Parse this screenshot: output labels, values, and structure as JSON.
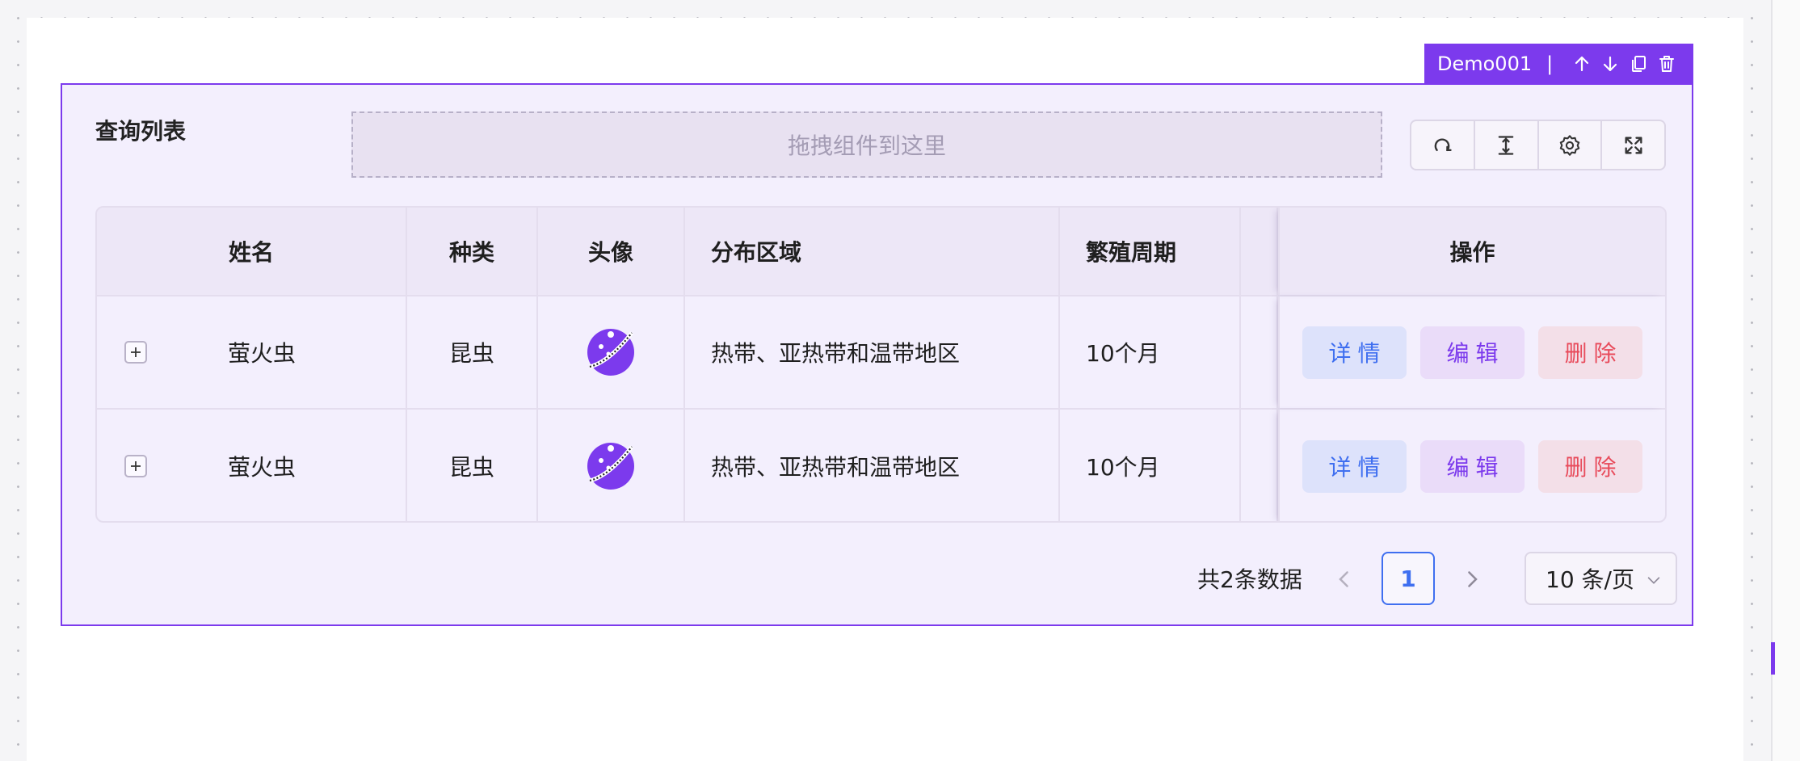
{
  "component_toolbar": {
    "name": "Demo001",
    "separator": "|",
    "icons": [
      "arrow-up-icon",
      "arrow-down-icon",
      "copy-icon",
      "trash-icon"
    ]
  },
  "list": {
    "title": "查询列表",
    "drop_zone_placeholder": "拖拽组件到这里",
    "tools": [
      "refresh-icon",
      "density-icon",
      "settings-icon",
      "fullscreen-icon"
    ]
  },
  "table": {
    "columns": {
      "name": "姓名",
      "type": "种类",
      "avatar": "头像",
      "region": "分布区域",
      "cycle": "繁殖周期",
      "ops": "操作"
    },
    "rows": [
      {
        "name": "萤火虫",
        "type": "昆虫",
        "region": "热带、亚热带和温带地区",
        "cycle": "10个月",
        "ops": {
          "detail": "详情",
          "edit": "编辑",
          "delete": "删除"
        }
      },
      {
        "name": "萤火虫",
        "type": "昆虫",
        "region": "热带、亚热带和温带地区",
        "cycle": "10个月",
        "ops": {
          "detail": "详情",
          "edit": "编辑",
          "delete": "删除"
        }
      }
    ]
  },
  "pagination": {
    "total_text": "共2条数据",
    "current_page": "1",
    "page_size": "10 条/页"
  },
  "colors": {
    "accent": "#7c3aed",
    "link_blue": "#3f6ff0",
    "danger_red": "#e84b5b"
  }
}
